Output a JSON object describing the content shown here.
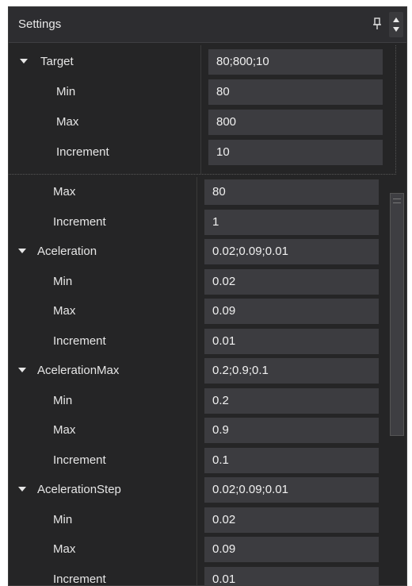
{
  "panel": {
    "title": "Settings"
  },
  "popup": {
    "rows": [
      {
        "label": "Target",
        "value": "80;800;10",
        "group": true
      },
      {
        "label": "Min",
        "value": "80",
        "group": false
      },
      {
        "label": "Max",
        "value": "800",
        "group": false
      },
      {
        "label": "Increment",
        "value": "10",
        "group": false
      }
    ]
  },
  "list": {
    "rows": [
      {
        "label": "Max",
        "value": "80",
        "group": false
      },
      {
        "label": "Increment",
        "value": "1",
        "group": false
      },
      {
        "label": "Aceleration",
        "value": "0.02;0.09;0.01",
        "group": true
      },
      {
        "label": "Min",
        "value": "0.02",
        "group": false
      },
      {
        "label": "Max",
        "value": "0.09",
        "group": false
      },
      {
        "label": "Increment",
        "value": "0.01",
        "group": false
      },
      {
        "label": "AcelerationMax",
        "value": "0.2;0.9;0.1",
        "group": true
      },
      {
        "label": "Min",
        "value": "0.2",
        "group": false
      },
      {
        "label": "Max",
        "value": "0.9",
        "group": false
      },
      {
        "label": "Increment",
        "value": "0.1",
        "group": false
      },
      {
        "label": "AcelerationStep",
        "value": "0.02;0.09;0.01",
        "group": true
      },
      {
        "label": "Min",
        "value": "0.02",
        "group": false
      },
      {
        "label": "Max",
        "value": "0.09",
        "group": false
      },
      {
        "label": "Increment",
        "value": "0.01",
        "group": false
      }
    ]
  },
  "colors": {
    "background": "#252526",
    "value_field": "#3c3c40",
    "text": "#e6e6e6"
  },
  "icons": {
    "pin": "pin-icon",
    "scroll": "scroll-updown-icon",
    "expand": "caret-down-icon"
  }
}
